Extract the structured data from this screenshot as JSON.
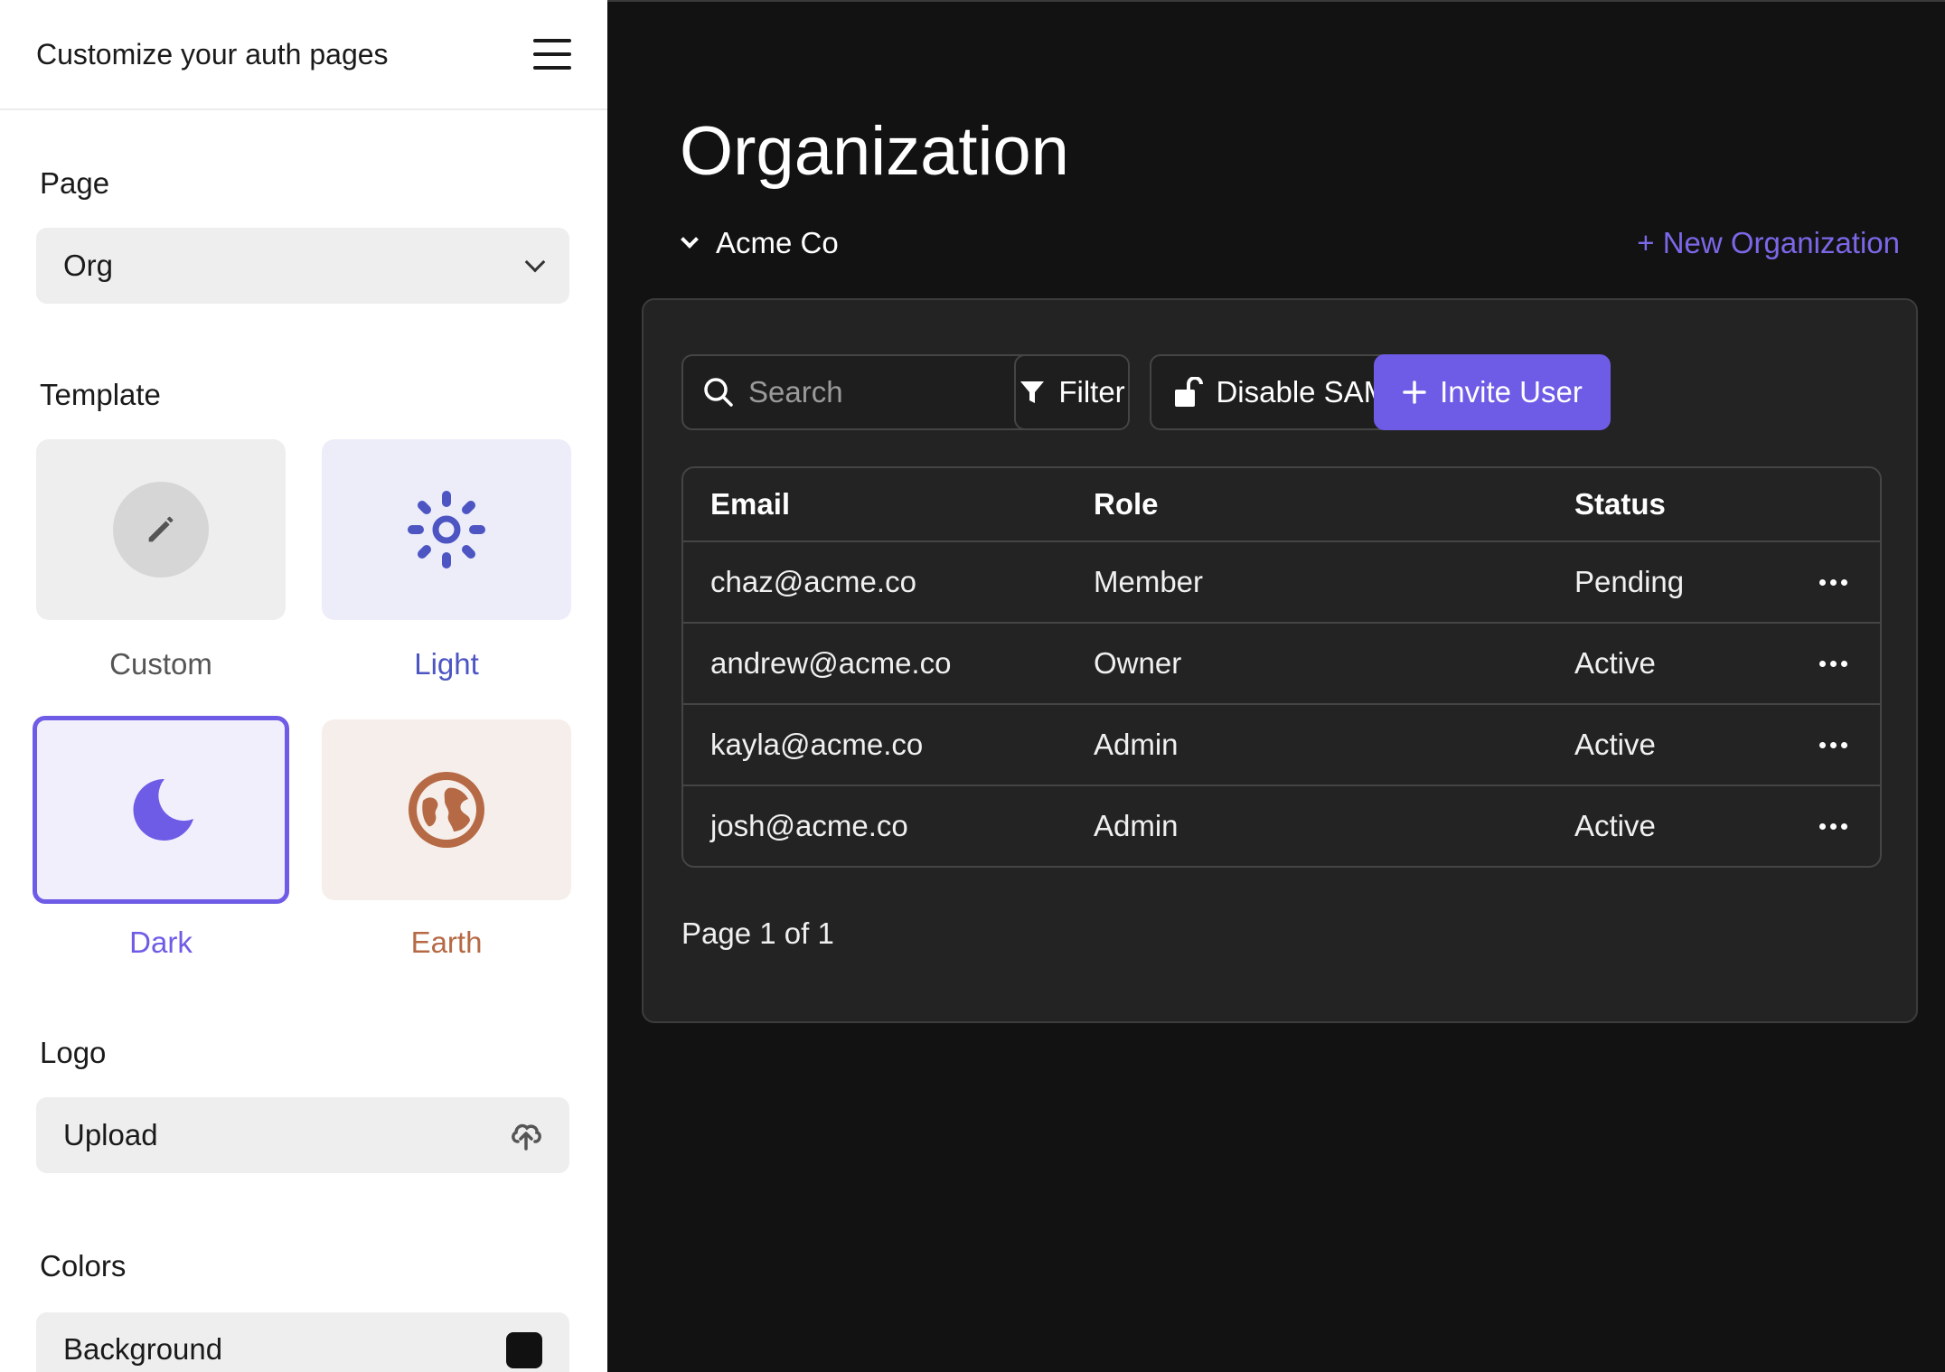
{
  "sidebar": {
    "title": "Customize your auth pages",
    "page_section": {
      "label": "Page",
      "selected": "Org"
    },
    "template_section": {
      "label": "Template",
      "templates": [
        {
          "label": "Custom",
          "icon": "pencil-icon",
          "color": "#555555"
        },
        {
          "label": "Light",
          "icon": "sun-icon",
          "color": "#4c55c2"
        },
        {
          "label": "Dark",
          "icon": "moon-icon",
          "color": "#6e5ce6",
          "selected": true
        },
        {
          "label": "Earth",
          "icon": "globe-icon",
          "color": "#b56a45"
        }
      ]
    },
    "logo_section": {
      "label": "Logo",
      "upload_label": "Upload",
      "icon": "upload-icon"
    },
    "colors_section": {
      "label": "Colors",
      "background_label": "Background",
      "background_swatch": "#111111"
    }
  },
  "main": {
    "title": "Organization",
    "org_name": "Acme Co",
    "new_org_label": "+ New Organization",
    "search_placeholder": "Search",
    "filter_label": "Filter",
    "disable_saml_label": "Disable SAML",
    "invite_label": "Invite User",
    "table": {
      "headers": [
        "Email",
        "Role",
        "Status"
      ],
      "rows": [
        {
          "email": "chaz@acme.co",
          "role": "Member",
          "status": "Pending"
        },
        {
          "email": "andrew@acme.co",
          "role": "Owner",
          "status": "Active"
        },
        {
          "email": "kayla@acme.co",
          "role": "Admin",
          "status": "Active"
        },
        {
          "email": "josh@acme.co",
          "role": "Admin",
          "status": "Active"
        }
      ]
    },
    "pager": "Page 1 of 1",
    "accent": "#6e5ce6"
  }
}
